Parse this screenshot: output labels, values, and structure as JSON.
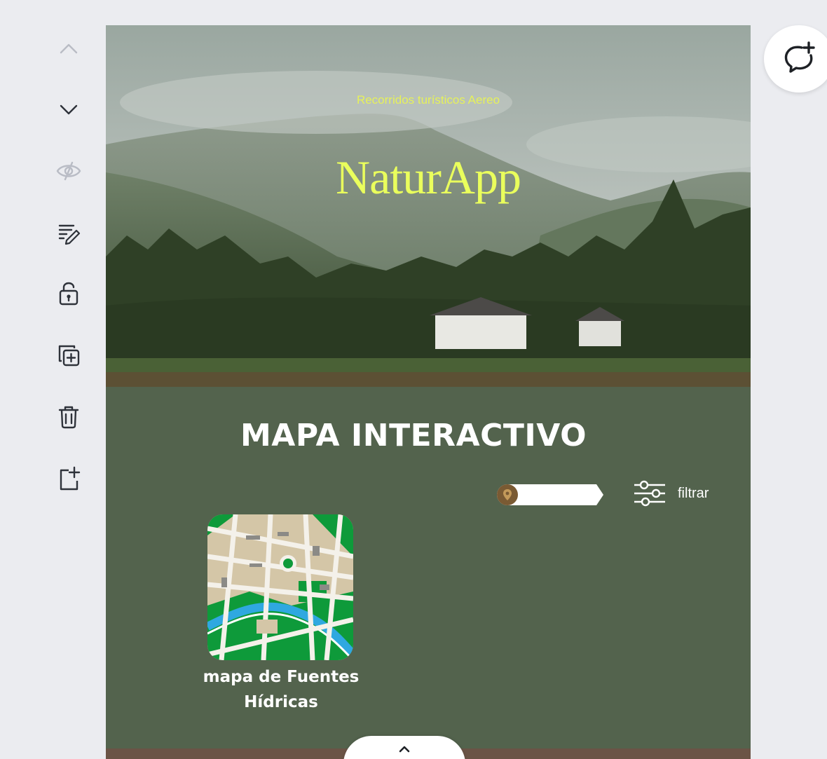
{
  "toolbar": {
    "items": [
      {
        "icon": "chevron-up-icon",
        "state": "disabled"
      },
      {
        "icon": "chevron-down-icon",
        "state": "enabled"
      },
      {
        "icon": "eye-hidden-icon",
        "state": "disabled"
      },
      {
        "icon": "notes-edit-icon",
        "state": "enabled"
      },
      {
        "icon": "unlock-icon",
        "state": "enabled"
      },
      {
        "icon": "duplicate-icon",
        "state": "enabled"
      },
      {
        "icon": "trash-icon",
        "state": "enabled"
      },
      {
        "icon": "add-page-icon",
        "state": "enabled"
      }
    ]
  },
  "hero": {
    "subtitle": "Recorridos turísticos Aereo",
    "brand": "NaturApp"
  },
  "section": {
    "title": "MAPA INTERACTIVO",
    "search_placeholder": "",
    "filter_label": "filtrar",
    "map_card_label_line1": "mapa de Fuentes",
    "map_card_label_line2": "Hídricas"
  },
  "colors": {
    "page_bg": "#53634d",
    "brand_yellow": "#eaff5c",
    "bottom_band": "#6b5446",
    "workspace_bg": "#ebecf0",
    "map_green": "#0e9a3a",
    "map_river": "#2fa8e0",
    "map_block": "#d4c6a7"
  },
  "floating": {
    "comment_icon": "comment-add-icon",
    "collapse_icon": "chevron-up-icon"
  }
}
